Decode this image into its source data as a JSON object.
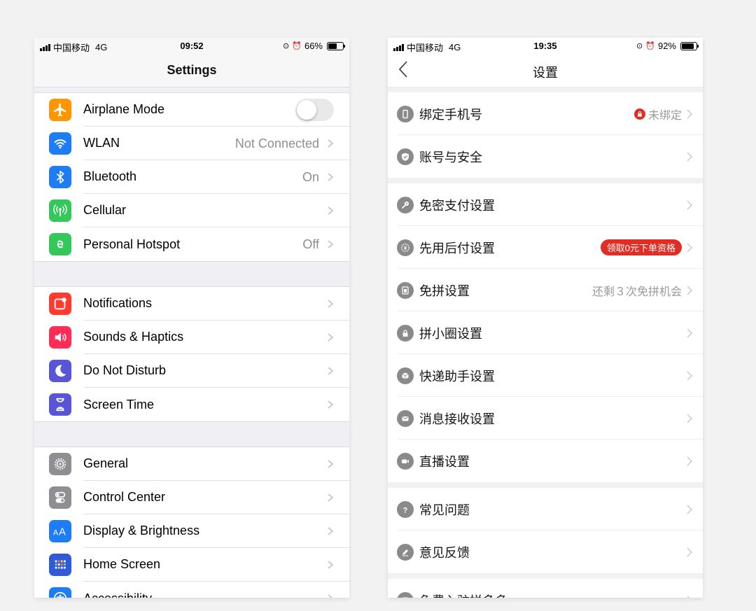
{
  "ios": {
    "status": {
      "carrier": "中国移动",
      "network": "4G",
      "time": "09:52",
      "battery": "66%",
      "battery_level": 0.66
    },
    "title": "Settings",
    "groups": [
      {
        "items": [
          {
            "label": "Airplane Mode",
            "icon": "airplane-icon",
            "color": "#ff9500",
            "toggle": false
          },
          {
            "label": "WLAN",
            "value": "Not Connected",
            "icon": "wifi-icon",
            "color": "#1e7cf6"
          },
          {
            "label": "Bluetooth",
            "value": "On",
            "icon": "bluetooth-icon",
            "color": "#1e7cf6"
          },
          {
            "label": "Cellular",
            "icon": "cellular-icon",
            "color": "#34c759"
          },
          {
            "label": "Personal Hotspot",
            "value": "Off",
            "icon": "hotspot-icon",
            "color": "#34c759"
          }
        ]
      },
      {
        "items": [
          {
            "label": "Notifications",
            "icon": "notifications-icon",
            "color": "#ff3b30"
          },
          {
            "label": "Sounds & Haptics",
            "icon": "speaker-icon",
            "color": "#ff2d55"
          },
          {
            "label": "Do Not Disturb",
            "icon": "moon-icon",
            "color": "#5856d6"
          },
          {
            "label": "Screen Time",
            "icon": "hourglass-icon",
            "color": "#5856d6"
          }
        ]
      },
      {
        "items": [
          {
            "label": "General",
            "icon": "gear-icon",
            "color": "#8e8e93"
          },
          {
            "label": "Control Center",
            "icon": "toggles-icon",
            "color": "#8e8e93"
          },
          {
            "label": "Display & Brightness",
            "icon": "text-size-icon",
            "color": "#1e7cf6"
          },
          {
            "label": "Home Screen",
            "icon": "grid-icon",
            "color": "#2f5bd8"
          },
          {
            "label": "Accessibility",
            "icon": "accessibility-icon",
            "color": "#1e7cf6"
          }
        ]
      }
    ]
  },
  "cn": {
    "status": {
      "carrier": "中国移动",
      "network": "4G",
      "time": "19:35",
      "battery": "92%",
      "battery_level": 0.92
    },
    "title": "设置",
    "groups": [
      {
        "items": [
          {
            "label": "绑定手机号",
            "icon": "phone-icon",
            "lock_value": "未绑定"
          },
          {
            "label": "账号与安全",
            "icon": "shield-icon"
          }
        ]
      },
      {
        "items": [
          {
            "label": "免密支付设置",
            "icon": "key-icon"
          },
          {
            "label": "先用后付设置",
            "icon": "coupon-icon",
            "badge": "领取0元下单资格"
          },
          {
            "label": "免拼设置",
            "icon": "card-icon",
            "value": "还剩３次免拼机会"
          },
          {
            "label": "拼小圈设置",
            "icon": "lock-icon"
          },
          {
            "label": "快递助手设置",
            "icon": "package-icon"
          },
          {
            "label": "消息接收设置",
            "icon": "mail-icon"
          },
          {
            "label": "直播设置",
            "icon": "video-icon"
          }
        ]
      },
      {
        "items": [
          {
            "label": "常见问题",
            "icon": "question-icon"
          },
          {
            "label": "意见反馈",
            "icon": "pen-icon"
          }
        ]
      },
      {
        "items": [
          {
            "label": "免费入驻拼多多",
            "icon": "store-icon"
          }
        ]
      }
    ]
  }
}
